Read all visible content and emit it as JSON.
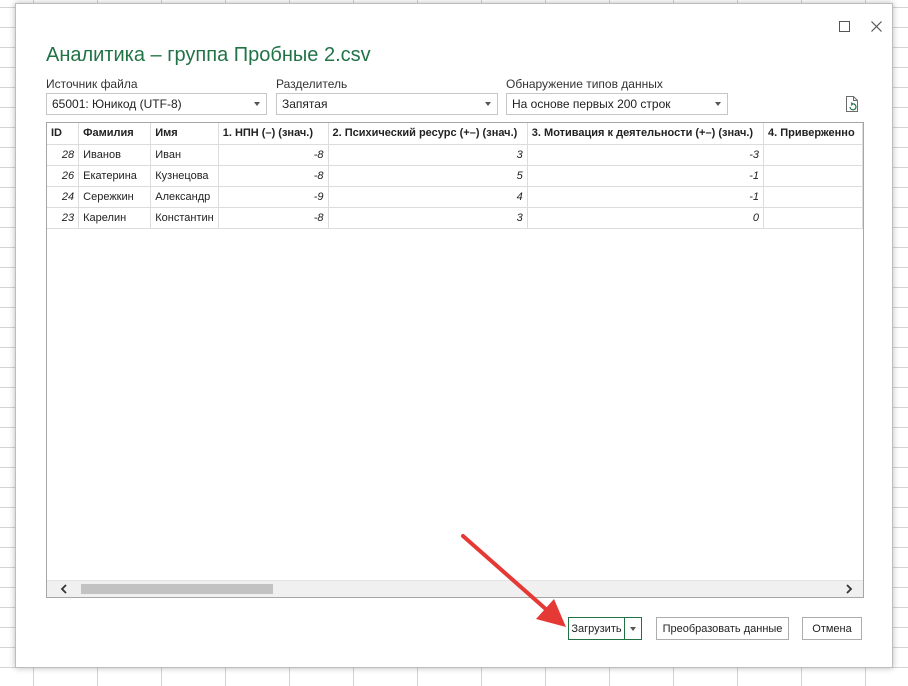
{
  "dialog": {
    "title": "Аналитика – группа Пробные 2.csv",
    "maximize_icon": "maximize-icon",
    "close_icon": "close-icon"
  },
  "options": {
    "file_origin": {
      "label": "Источник файла",
      "value": "65001: Юникод (UTF-8)"
    },
    "delimiter": {
      "label": "Разделитель",
      "value": "Запятая"
    },
    "data_type_detection": {
      "label": "Обнаружение типов данных",
      "value": "На основе первых 200 строк"
    },
    "refresh_icon": "refresh-document-icon"
  },
  "table": {
    "columns": [
      "ID",
      "Фамилия",
      "Имя",
      "1. НПН (–) (знач.)",
      "2. Психический ресурс (+–) (знач.)",
      "3. Мотивация к деятельности (+–) (знач.)",
      "4. Приверженно"
    ],
    "rows": [
      [
        "28",
        "Иванов",
        "Иван",
        "-8",
        "3",
        "-3",
        ""
      ],
      [
        "26",
        "Екатерина",
        "Кузнецова",
        "-8",
        "5",
        "-1",
        ""
      ],
      [
        "24",
        "Сережкин",
        "Александр",
        "-9",
        "4",
        "-1",
        ""
      ],
      [
        "23",
        "Карелин",
        "Константин",
        "-8",
        "3",
        "0",
        ""
      ]
    ]
  },
  "buttons": {
    "load": "Загрузить",
    "transform": "Преобразовать данные",
    "cancel": "Отмена"
  },
  "colors": {
    "accent": "#217346",
    "annotation_arrow": "#e53935"
  }
}
